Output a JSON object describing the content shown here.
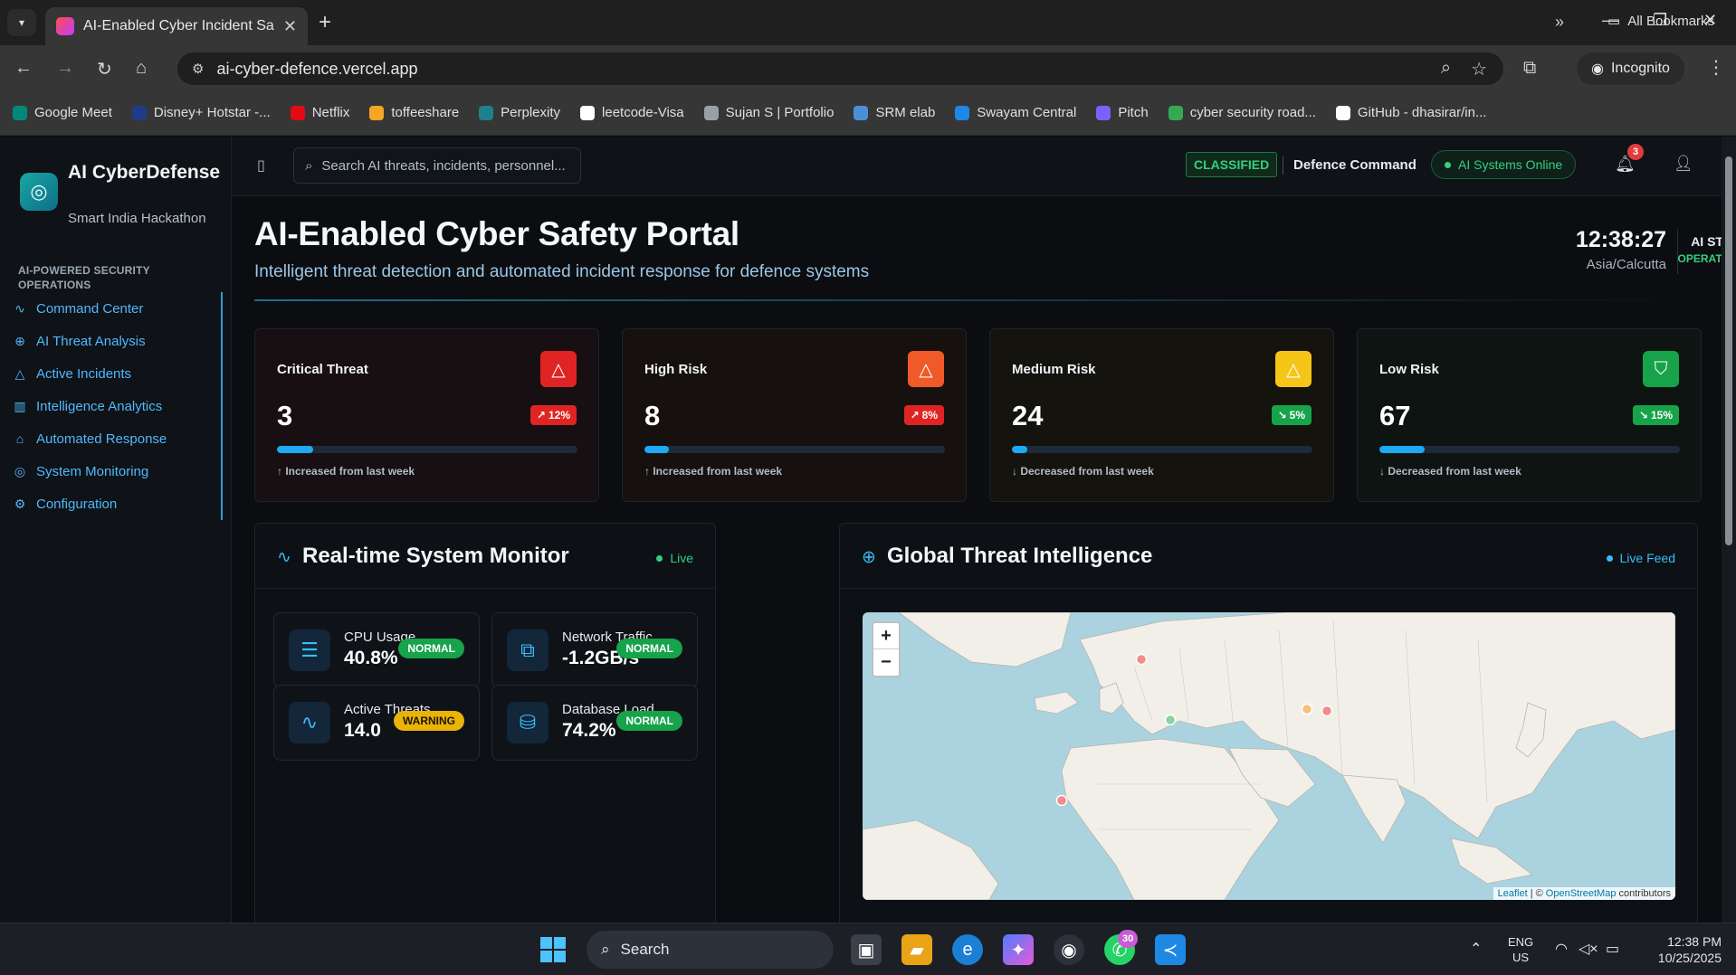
{
  "browser": {
    "tab_title": "AI-Enabled Cyber Incident Safet",
    "url": "ai-cyber-defence.vercel.app",
    "incognito_label": "Incognito",
    "bookmarks": [
      {
        "label": "Google Meet",
        "color": "#00897b"
      },
      {
        "label": "Disney+ Hotstar -...",
        "color": "#1f3c88"
      },
      {
        "label": "Netflix",
        "color": "#e50914"
      },
      {
        "label": "toffeeshare",
        "color": "#f5a623"
      },
      {
        "label": "Perplexity",
        "color": "#20808d"
      },
      {
        "label": "leetcode-Visa",
        "color": "#ffffff"
      },
      {
        "label": "Sujan S | Portfolio",
        "color": "#9aa0a6"
      },
      {
        "label": "SRM elab",
        "color": "#4a90d9"
      },
      {
        "label": "Swayam Central",
        "color": "#1e88e5"
      },
      {
        "label": "Pitch",
        "color": "#7b61ff"
      },
      {
        "label": "cyber security road...",
        "color": "#34a853"
      },
      {
        "label": "GitHub - dhasirar/in...",
        "color": "#ffffff"
      }
    ],
    "all_bookmarks_label": "All Bookmarks"
  },
  "sidebar": {
    "title": "AI CyberDefense",
    "subtitle": "Smart India Hackathon",
    "section_label": "AI-POWERED SECURITY OPERATIONS",
    "items": [
      {
        "label": "Command Center",
        "icon": "activity-icon"
      },
      {
        "label": "AI Threat Analysis",
        "icon": "brain-icon"
      },
      {
        "label": "Active Incidents",
        "icon": "alert-triangle-icon"
      },
      {
        "label": "Intelligence Analytics",
        "icon": "bar-chart-icon"
      },
      {
        "label": "Automated Response",
        "icon": "bot-icon"
      },
      {
        "label": "System Monitoring",
        "icon": "eye-icon"
      },
      {
        "label": "Configuration",
        "icon": "gear-icon"
      }
    ]
  },
  "topbar": {
    "search_placeholder": "Search AI threats, incidents, personnel...",
    "classified": "CLASSIFIED",
    "command": "Defence Command",
    "systems_status": "AI Systems Online",
    "notification_count": "3"
  },
  "header": {
    "title": "AI-Enabled Cyber Safety Portal",
    "subtitle": "Intelligent threat detection and automated incident response for defence systems",
    "time": "12:38:27",
    "timezone": "Asia/Calcutta",
    "ai_status_label": "AI STATUS",
    "ai_status_value": "OPERATIONAL"
  },
  "cards": [
    {
      "label": "Critical Threat",
      "value": "3",
      "change": "12%",
      "trend": "up",
      "progress": 0.12,
      "note": "↑ Increased from last week",
      "icon_color": "#e02424",
      "pill_color": "#e02424",
      "bg": "#170f12"
    },
    {
      "label": "High Risk",
      "value": "8",
      "change": "8%",
      "trend": "up",
      "progress": 0.08,
      "note": "↑ Increased from last week",
      "icon_color": "#f05a28",
      "pill_color": "#e02424",
      "bg": "#16110f"
    },
    {
      "label": "Medium Risk",
      "value": "24",
      "change": "5%",
      "trend": "down",
      "progress": 0.05,
      "note": "↓ Decreased from last week",
      "icon_color": "#f5c518",
      "pill_color": "#16a34a",
      "bg": "#14130e"
    },
    {
      "label": "Low Risk",
      "value": "67",
      "change": "15%",
      "trend": "down",
      "progress": 0.15,
      "note": "↓ Decreased from last week",
      "icon_color": "#16a34a",
      "pill_color": "#16a34a",
      "bg": "#0e1411"
    }
  ],
  "monitor": {
    "title": "Real-time System Monitor",
    "live": "Live",
    "metrics": [
      {
        "label": "CPU Usage",
        "value": "40.8%",
        "status": "NORMAL",
        "status_color": "#16a34a",
        "icon": "server-icon"
      },
      {
        "label": "Network Traffic",
        "value": "-1.2GB/s",
        "status": "NORMAL",
        "status_color": "#16a34a",
        "icon": "network-icon"
      },
      {
        "label": "Active Threats",
        "value": "14.0",
        "status": "WARNING",
        "status_color": "#eab308",
        "icon": "pulse-icon"
      },
      {
        "label": "Database Load",
        "value": "74.2%",
        "status": "NORMAL",
        "status_color": "#16a34a",
        "icon": "database-icon"
      }
    ]
  },
  "intel": {
    "title": "Global Threat Intelligence",
    "live": "Live Feed",
    "attribution_leaflet": "Leaflet",
    "attribution_osm": "OpenStreetMap",
    "attribution_rest": "contributors",
    "markers": [
      {
        "name": "moscow",
        "severity": "high",
        "color": "#f28b8b"
      },
      {
        "name": "middle-east",
        "severity": "low",
        "color": "#86d6a0"
      },
      {
        "name": "beijing",
        "severity": "medium",
        "color": "#f6c177"
      },
      {
        "name": "korea",
        "severity": "high",
        "color": "#f28b8b"
      },
      {
        "name": "gulf-of-guinea",
        "severity": "high",
        "color": "#f28b8b"
      }
    ]
  },
  "taskbar": {
    "search_label": "Search",
    "whatsapp_badge": "30",
    "lang_top": "ENG",
    "lang_bottom": "US",
    "time": "12:38 PM",
    "date": "10/25/2025"
  }
}
